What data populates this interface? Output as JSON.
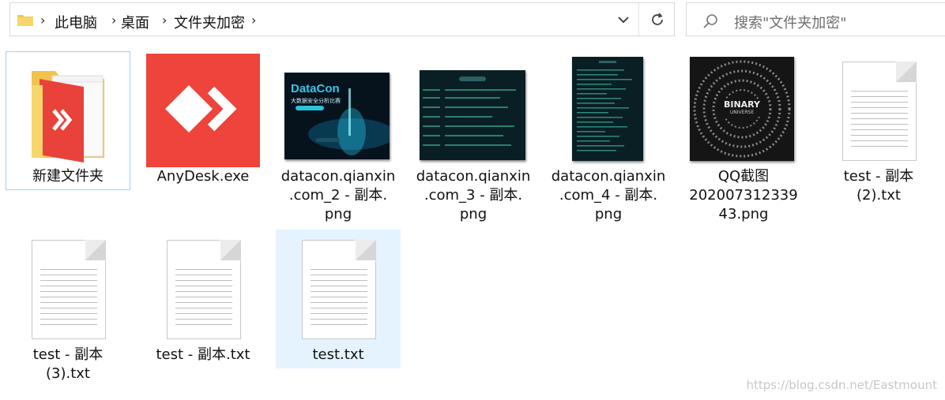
{
  "address_bar": {
    "breadcrumbs": [
      "此电脑",
      "桌面",
      "文件夹加密"
    ],
    "icons": [
      "folder-icon",
      "chevron-down-icon",
      "refresh-icon"
    ]
  },
  "search": {
    "placeholder": "搜索\"文件夹加密\""
  },
  "files": [
    {
      "name": "新建文件夹",
      "type": "folder"
    },
    {
      "name": "AnyDesk.exe",
      "type": "exe"
    },
    {
      "name": "datacon.qianxin\n.com_2 - 副本.\npng",
      "type": "png",
      "thumb_title": "DataCon",
      "thumb_subtitle": "大数据安全分析比赛"
    },
    {
      "name": "datacon.qianxin\n.com_3 - 副本.\npng",
      "type": "png"
    },
    {
      "name": "datacon.qianxin\n.com_4 - 副本.\npng",
      "type": "png"
    },
    {
      "name": "QQ截图\n202007312339\n43.png",
      "type": "png",
      "thumb_title": "BINARY",
      "thumb_subtitle": "UNIVERSE"
    },
    {
      "name": "test - 副本\n(2).txt",
      "type": "txt"
    },
    {
      "name": "test - 副本\n(3).txt",
      "type": "txt"
    },
    {
      "name": "test - 副本.txt",
      "type": "txt"
    },
    {
      "name": "test.txt",
      "type": "txt",
      "selected": true
    }
  ],
  "colors": {
    "anydesk": "#ef443b",
    "selection": "#e5f3ff",
    "focus_border": "#99d1ff",
    "folder": "#f7d56a"
  },
  "watermark": "https://blog.csdn.net/Eastmount"
}
